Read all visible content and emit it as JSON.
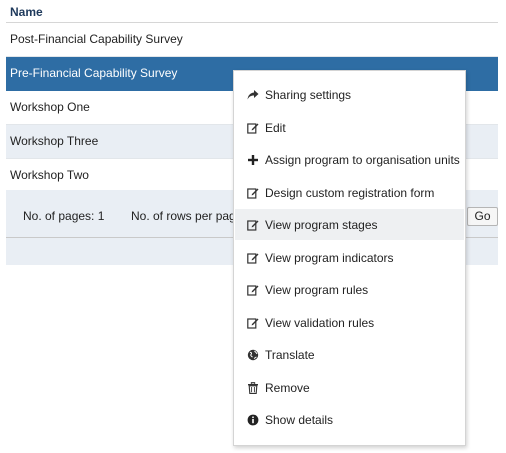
{
  "table": {
    "header": "Name",
    "rows": [
      "Post-Financial Capability Survey",
      "Pre-Financial Capability Survey",
      "Workshop One",
      "Workshop Three",
      "Workshop Two"
    ],
    "selected_row": "Pre-Financial Capability Survey"
  },
  "pager": {
    "pages_label": "No. of pages: 1",
    "rows_per_page_label": "No. of rows per page:",
    "go_label": "Go"
  },
  "context_menu": {
    "items": [
      {
        "label": "Sharing settings",
        "icon": "share-icon"
      },
      {
        "label": "Edit",
        "icon": "edit-icon"
      },
      {
        "label": "Assign program to organisation units",
        "icon": "plus-icon"
      },
      {
        "label": "Design custom registration form",
        "icon": "edit-icon"
      },
      {
        "label": "View program stages",
        "icon": "edit-icon"
      },
      {
        "label": "View program indicators",
        "icon": "edit-icon"
      },
      {
        "label": "View program rules",
        "icon": "edit-icon"
      },
      {
        "label": "View validation rules",
        "icon": "edit-icon"
      },
      {
        "label": "Translate",
        "icon": "globe-icon"
      },
      {
        "label": "Remove",
        "icon": "trash-icon"
      },
      {
        "label": "Show details",
        "icon": "info-icon"
      }
    ],
    "hovered_item": "View program stages"
  },
  "colors": {
    "selected_row": "#2e6da4",
    "alt_row": "#e9eef4",
    "header_text": "#1f3a5c"
  }
}
